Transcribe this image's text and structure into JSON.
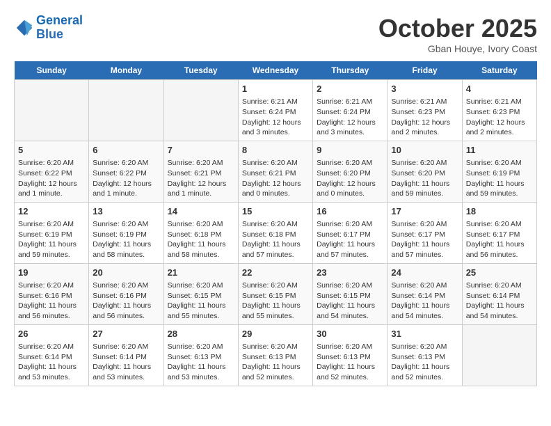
{
  "header": {
    "logo_line1": "General",
    "logo_line2": "Blue",
    "month": "October 2025",
    "location": "Gban Houye, Ivory Coast"
  },
  "days_of_week": [
    "Sunday",
    "Monday",
    "Tuesday",
    "Wednesday",
    "Thursday",
    "Friday",
    "Saturday"
  ],
  "weeks": [
    [
      {
        "day": "",
        "content": ""
      },
      {
        "day": "",
        "content": ""
      },
      {
        "day": "",
        "content": ""
      },
      {
        "day": "1",
        "content": "Sunrise: 6:21 AM\nSunset: 6:24 PM\nDaylight: 12 hours and 3 minutes."
      },
      {
        "day": "2",
        "content": "Sunrise: 6:21 AM\nSunset: 6:24 PM\nDaylight: 12 hours and 3 minutes."
      },
      {
        "day": "3",
        "content": "Sunrise: 6:21 AM\nSunset: 6:23 PM\nDaylight: 12 hours and 2 minutes."
      },
      {
        "day": "4",
        "content": "Sunrise: 6:21 AM\nSunset: 6:23 PM\nDaylight: 12 hours and 2 minutes."
      }
    ],
    [
      {
        "day": "5",
        "content": "Sunrise: 6:20 AM\nSunset: 6:22 PM\nDaylight: 12 hours and 1 minute."
      },
      {
        "day": "6",
        "content": "Sunrise: 6:20 AM\nSunset: 6:22 PM\nDaylight: 12 hours and 1 minute."
      },
      {
        "day": "7",
        "content": "Sunrise: 6:20 AM\nSunset: 6:21 PM\nDaylight: 12 hours and 1 minute."
      },
      {
        "day": "8",
        "content": "Sunrise: 6:20 AM\nSunset: 6:21 PM\nDaylight: 12 hours and 0 minutes."
      },
      {
        "day": "9",
        "content": "Sunrise: 6:20 AM\nSunset: 6:20 PM\nDaylight: 12 hours and 0 minutes."
      },
      {
        "day": "10",
        "content": "Sunrise: 6:20 AM\nSunset: 6:20 PM\nDaylight: 11 hours and 59 minutes."
      },
      {
        "day": "11",
        "content": "Sunrise: 6:20 AM\nSunset: 6:19 PM\nDaylight: 11 hours and 59 minutes."
      }
    ],
    [
      {
        "day": "12",
        "content": "Sunrise: 6:20 AM\nSunset: 6:19 PM\nDaylight: 11 hours and 59 minutes."
      },
      {
        "day": "13",
        "content": "Sunrise: 6:20 AM\nSunset: 6:19 PM\nDaylight: 11 hours and 58 minutes."
      },
      {
        "day": "14",
        "content": "Sunrise: 6:20 AM\nSunset: 6:18 PM\nDaylight: 11 hours and 58 minutes."
      },
      {
        "day": "15",
        "content": "Sunrise: 6:20 AM\nSunset: 6:18 PM\nDaylight: 11 hours and 57 minutes."
      },
      {
        "day": "16",
        "content": "Sunrise: 6:20 AM\nSunset: 6:17 PM\nDaylight: 11 hours and 57 minutes."
      },
      {
        "day": "17",
        "content": "Sunrise: 6:20 AM\nSunset: 6:17 PM\nDaylight: 11 hours and 57 minutes."
      },
      {
        "day": "18",
        "content": "Sunrise: 6:20 AM\nSunset: 6:17 PM\nDaylight: 11 hours and 56 minutes."
      }
    ],
    [
      {
        "day": "19",
        "content": "Sunrise: 6:20 AM\nSunset: 6:16 PM\nDaylight: 11 hours and 56 minutes."
      },
      {
        "day": "20",
        "content": "Sunrise: 6:20 AM\nSunset: 6:16 PM\nDaylight: 11 hours and 56 minutes."
      },
      {
        "day": "21",
        "content": "Sunrise: 6:20 AM\nSunset: 6:15 PM\nDaylight: 11 hours and 55 minutes."
      },
      {
        "day": "22",
        "content": "Sunrise: 6:20 AM\nSunset: 6:15 PM\nDaylight: 11 hours and 55 minutes."
      },
      {
        "day": "23",
        "content": "Sunrise: 6:20 AM\nSunset: 6:15 PM\nDaylight: 11 hours and 54 minutes."
      },
      {
        "day": "24",
        "content": "Sunrise: 6:20 AM\nSunset: 6:14 PM\nDaylight: 11 hours and 54 minutes."
      },
      {
        "day": "25",
        "content": "Sunrise: 6:20 AM\nSunset: 6:14 PM\nDaylight: 11 hours and 54 minutes."
      }
    ],
    [
      {
        "day": "26",
        "content": "Sunrise: 6:20 AM\nSunset: 6:14 PM\nDaylight: 11 hours and 53 minutes."
      },
      {
        "day": "27",
        "content": "Sunrise: 6:20 AM\nSunset: 6:14 PM\nDaylight: 11 hours and 53 minutes."
      },
      {
        "day": "28",
        "content": "Sunrise: 6:20 AM\nSunset: 6:13 PM\nDaylight: 11 hours and 53 minutes."
      },
      {
        "day": "29",
        "content": "Sunrise: 6:20 AM\nSunset: 6:13 PM\nDaylight: 11 hours and 52 minutes."
      },
      {
        "day": "30",
        "content": "Sunrise: 6:20 AM\nSunset: 6:13 PM\nDaylight: 11 hours and 52 minutes."
      },
      {
        "day": "31",
        "content": "Sunrise: 6:20 AM\nSunset: 6:13 PM\nDaylight: 11 hours and 52 minutes."
      },
      {
        "day": "",
        "content": ""
      }
    ]
  ]
}
